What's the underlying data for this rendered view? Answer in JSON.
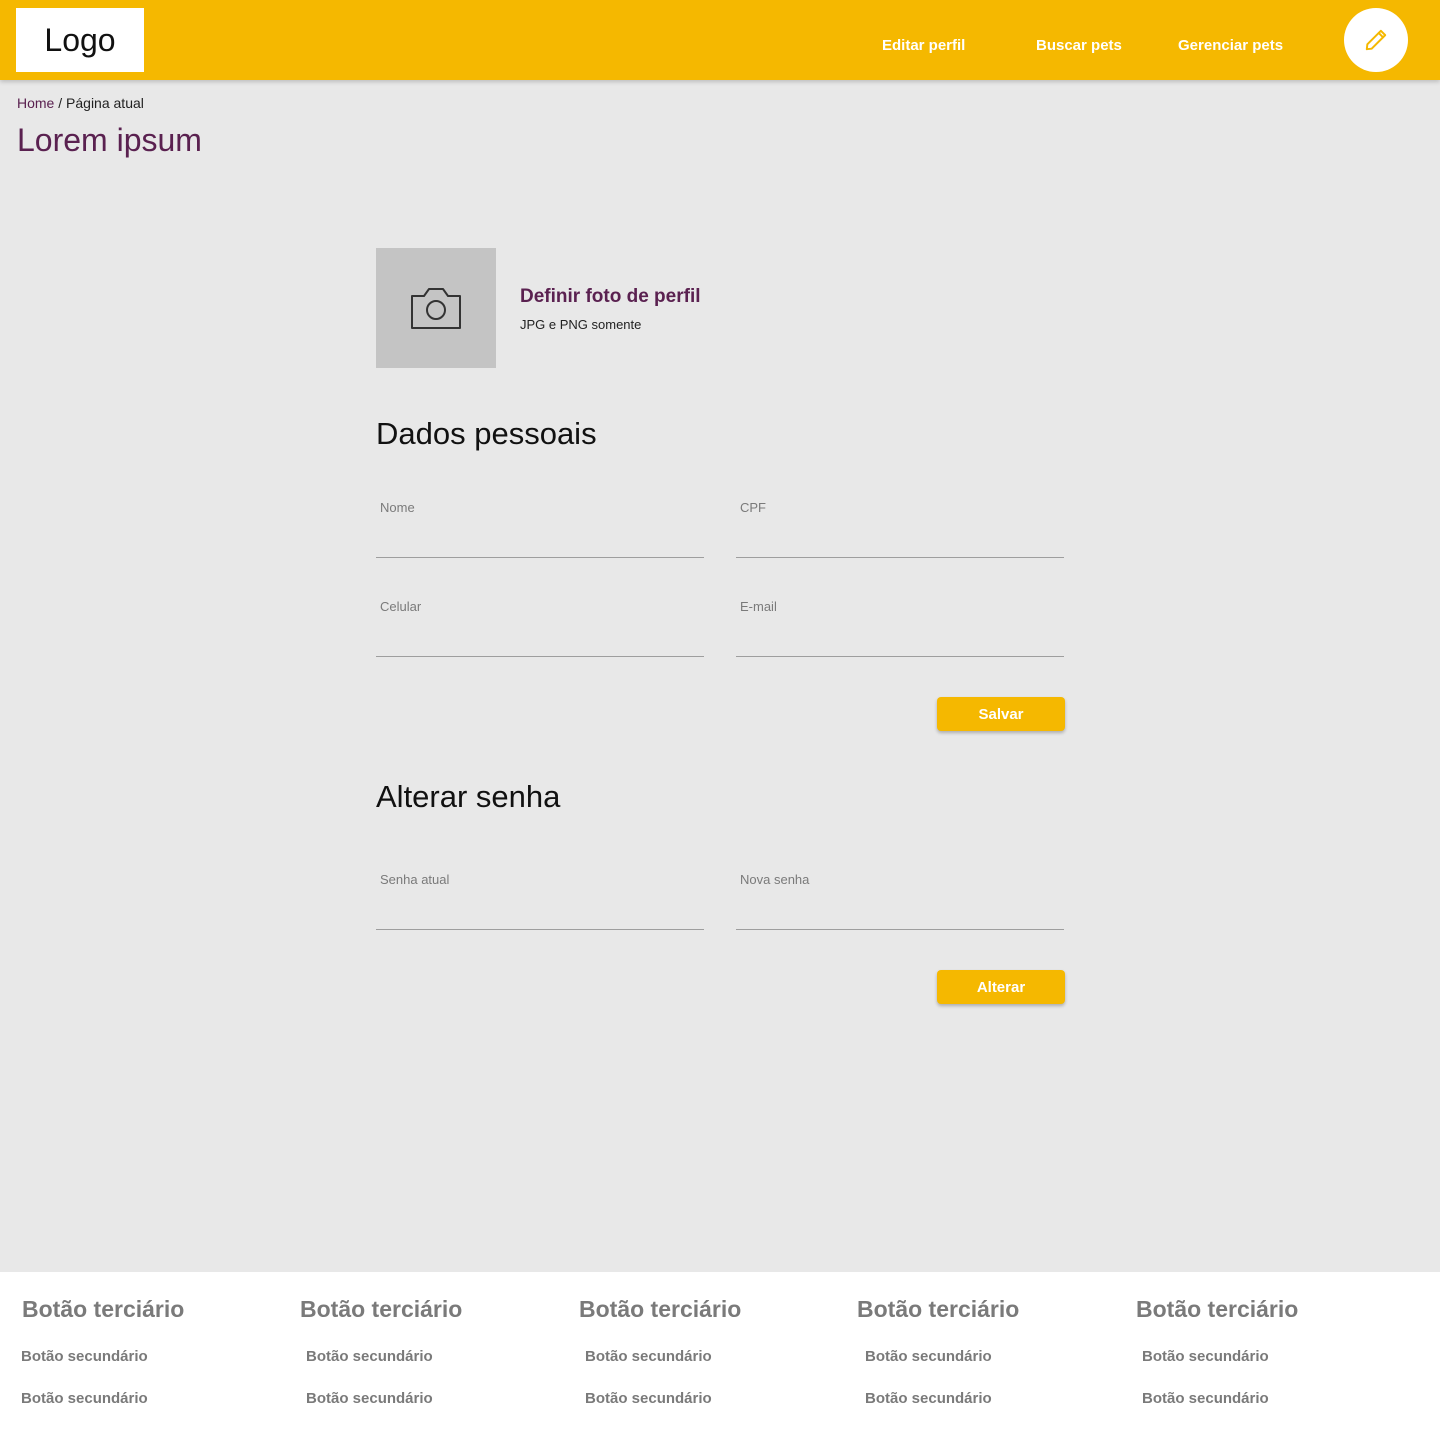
{
  "header": {
    "logo": "Logo",
    "nav": {
      "edit_profile": "Editar perfil",
      "search_pets": "Buscar pets",
      "manage_pets": "Gerenciar pets"
    },
    "fab_icon": "pencil-icon"
  },
  "breadcrumb": {
    "home": "Home",
    "separator": " / ",
    "current": "Página atual"
  },
  "page_title": "Lorem ipsum",
  "profile_photo": {
    "icon": "camera-icon",
    "title": "Definir foto de perfil",
    "hint": "JPG e PNG somente"
  },
  "personal": {
    "title": "Dados pessoais",
    "fields": {
      "nome": "Nome",
      "cpf": "CPF",
      "celular": "Celular",
      "email": "E-mail"
    },
    "save_label": "Salvar"
  },
  "password": {
    "title": "Alterar senha",
    "fields": {
      "current": "Senha atual",
      "new": "Nova senha"
    },
    "change_label": "Alterar"
  },
  "footer": {
    "columns": [
      {
        "tertiary": "Botão terciário",
        "secondary": [
          "Botão secundário",
          "Botão secundário"
        ]
      },
      {
        "tertiary": "Botão terciário",
        "secondary": [
          "Botão secundário",
          "Botão secundário"
        ]
      },
      {
        "tertiary": "Botão terciário",
        "secondary": [
          "Botão secundário",
          "Botão secundário"
        ]
      },
      {
        "tertiary": "Botão terciário",
        "secondary": [
          "Botão secundário",
          "Botão secundário"
        ]
      },
      {
        "tertiary": "Botão terciário",
        "secondary": [
          "Botão secundário",
          "Botão secundário"
        ]
      }
    ]
  },
  "colors": {
    "primary": "#f5b800",
    "accent": "#5a2150",
    "background": "#e8e8e8"
  }
}
